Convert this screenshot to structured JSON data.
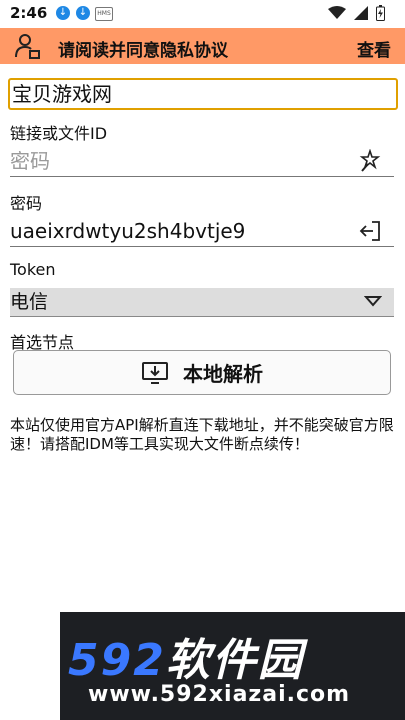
{
  "statusbar": {
    "time": "2:46",
    "hms_label": "HMS"
  },
  "header": {
    "title": "请阅读并同意隐私协议",
    "action": "查看"
  },
  "site": {
    "value": "宝贝游戏网"
  },
  "link": {
    "label": "链接或文件ID",
    "placeholder": "密码"
  },
  "password": {
    "label": "密码",
    "value": "uaeixrdwtyu2sh4bvtje9"
  },
  "token": {
    "label": "Token"
  },
  "node": {
    "selected": "电信",
    "label": "首选节点"
  },
  "parse_button": {
    "label": "本地解析"
  },
  "description": "本站仅使用官方API解析直连下载地址，并不能突破官方限速！请搭配IDM等工具实现大文件断点续传！",
  "watermark": {
    "big_num": "592",
    "big_text": "软件园",
    "url": "www.592xiazai.com"
  },
  "colors": {
    "header_bg": "#ff9966",
    "input_border": "#e0a000"
  }
}
